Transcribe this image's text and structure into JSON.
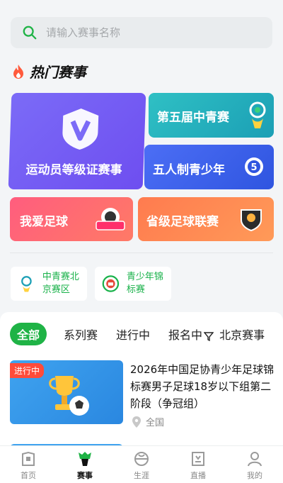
{
  "search": {
    "placeholder": "请输入赛事名称"
  },
  "hot": {
    "title": "热门赛事"
  },
  "cards": {
    "athlete": "运动员等级证赛事",
    "fifth": "第五届中青赛",
    "five_a_side": "五人制青少年",
    "love_football": "我爱足球",
    "provincial": "省级足球联赛"
  },
  "chips": [
    {
      "label": "中青赛北京赛区"
    },
    {
      "label": "青少年锦标赛"
    }
  ],
  "tabs": [
    "全部",
    "系列赛",
    "进行中",
    "报名中",
    "北京赛事"
  ],
  "event": {
    "status": "进行中",
    "title": "2026年中国足协青少年足球锦标赛男子足球18岁以下组第二阶段（争冠组）",
    "location": "全国"
  },
  "nav": [
    "首页",
    "赛事",
    "生涯",
    "直播",
    "我的"
  ],
  "colors": {
    "accent": "#1fb346",
    "live_tag": "#ff4b3a"
  }
}
